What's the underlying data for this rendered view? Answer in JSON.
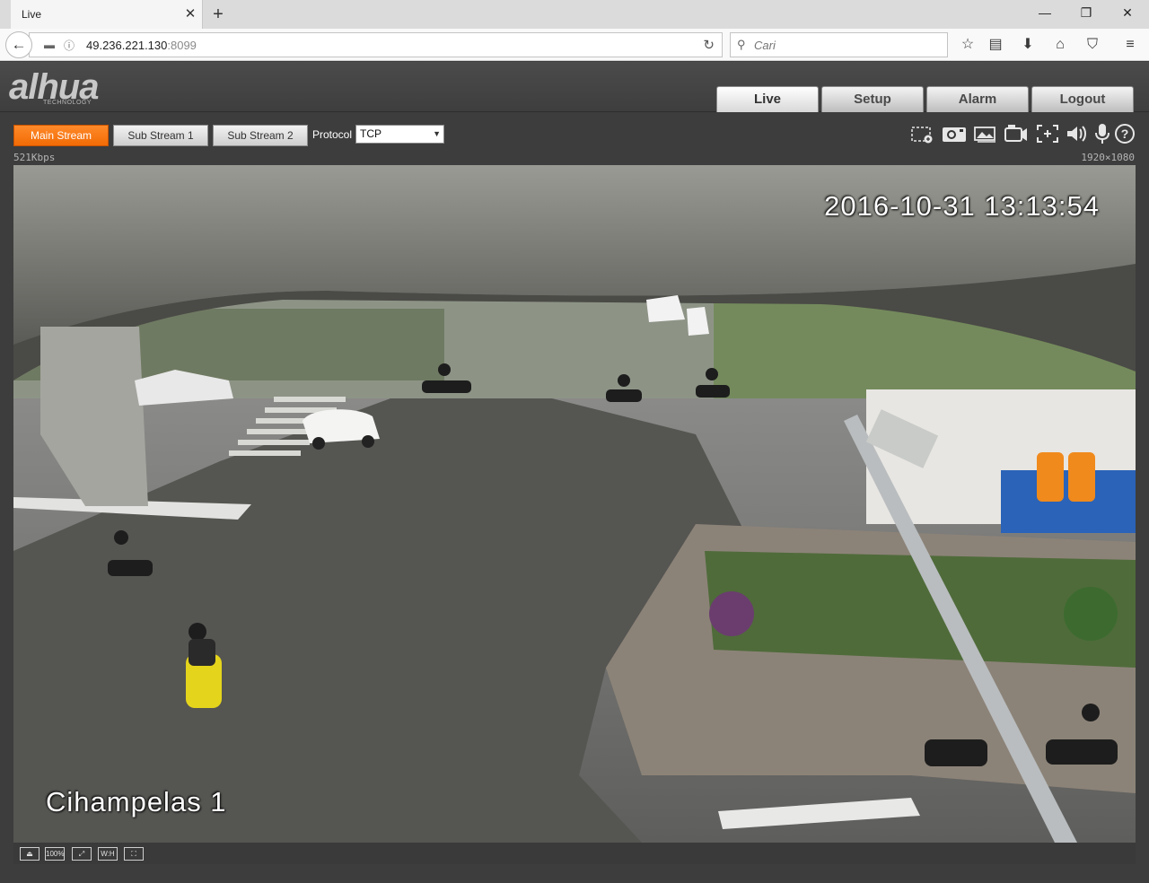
{
  "browser": {
    "tab_title": "Live",
    "tab_close": "✕",
    "new_tab": "+",
    "url_host": "49.236.221.130",
    "url_port": ":8099",
    "search_placeholder": "Cari",
    "window": {
      "minimize": "—",
      "restore": "❐",
      "close": "✕"
    },
    "toolbar_icons": [
      "bookmark-star-icon",
      "reading-list-icon",
      "download-icon",
      "home-icon",
      "pocket-icon",
      "menu-icon"
    ]
  },
  "app": {
    "logo_text": "alhua",
    "logo_subtext": "TECHNOLOGY",
    "nav_tabs": [
      "Live",
      "Setup",
      "Alarm",
      "Logout"
    ],
    "active_tab": "Live",
    "streams": {
      "main": "Main Stream",
      "sub1": "Sub Stream 1",
      "sub2": "Sub Stream 2"
    },
    "protocol_label": "Protocol",
    "protocol_value": "TCP",
    "bitrate": "521Kbps",
    "resolution": "1920×1080",
    "osd_timestamp": "2016-10-31 13:13:54",
    "osd_camera_name": "Cihampelas 1",
    "bottom_controls": {
      "zoom_label": "100%",
      "wh_label": "W:H"
    },
    "accent_color": "#f26b05"
  }
}
